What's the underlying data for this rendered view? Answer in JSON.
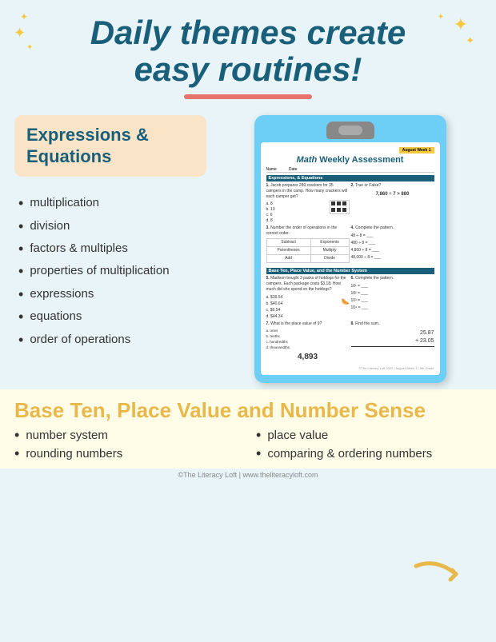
{
  "header": {
    "title_line1": "Daily themes create",
    "title_line2": "easy routines!"
  },
  "expressions_section": {
    "title": "Expressions &",
    "title2": "Equations",
    "bullets": [
      "multiplication",
      "division",
      "factors & multiples",
      "properties of multiplication",
      "expressions",
      "equations",
      "order of operations"
    ]
  },
  "worksheet": {
    "date_tag": "August Week 1",
    "title_italic": "Math",
    "title_rest": "Weekly Assessment",
    "name_label": "Name",
    "date_label": "Date",
    "section1_title": "Expressions, & Equations",
    "q1_text": "Jacob prepares 280 crackers for 35 campers in the camp. How many crackers will each camper get?",
    "q2_label": "True or False?",
    "q2_equation": "7,860 ÷ 7 > 880",
    "q3_label": "Number the order of operations in the correct order.",
    "q4_label": "Complete the pattern.",
    "section2_title": "Base Ten, Place Value, and the Number System",
    "q5_label": "Madison bought 3 packs of hotdogs for the campers. Each package costs $3.18. How much did she spend on the hotdogs?",
    "q6_label": "Complete the pattern.",
    "q7_label": "What is the place value of 9?",
    "q7_number": "4,893",
    "q8_label": "Find the sum.",
    "q8_sum": "25.87 + 23.05"
  },
  "base_ten_section": {
    "title": "Base Ten, Place Value and Number Sense",
    "bullets": [
      "number system",
      "place value",
      "rounding numbers",
      "comparing & ordering numbers"
    ]
  },
  "footer": {
    "text": "©The Literacy Loft  |  www.theliteracyloft.com"
  },
  "decorations": {
    "star_symbol": "✦",
    "sparkle_symbol": "✦",
    "arrow": "➜"
  }
}
